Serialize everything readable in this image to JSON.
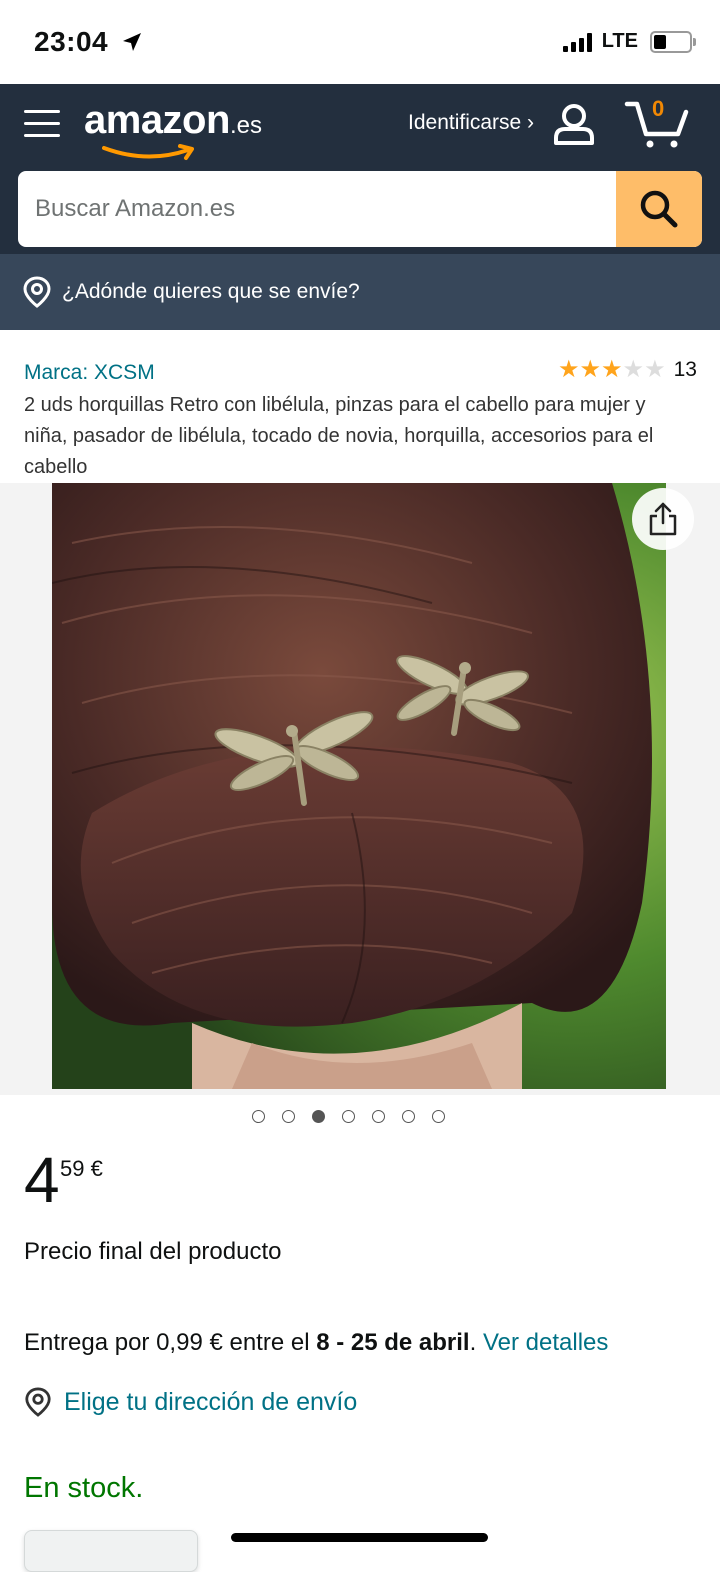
{
  "status_bar": {
    "time": "23:04",
    "network": "LTE"
  },
  "header": {
    "logo_word": "amazon",
    "logo_tld": ".es",
    "signin_label": "Identificarse ›",
    "cart_count": "0"
  },
  "search": {
    "placeholder": "Buscar Amazon.es"
  },
  "delivery_bar": {
    "text": "¿Adónde quieres que se envíe?"
  },
  "product": {
    "brand": "Marca: XCSM",
    "rating": 3,
    "rating_max": 5,
    "rating_count": "13",
    "title": "2 uds horquillas Retro con libélula, pinzas para el cabello para mujer y niña, pasador de libélula, tocado de novia, horquilla, accesorios para el cabello",
    "image_count": 7,
    "image_active_index": 2,
    "price_whole": "4",
    "price_fraction": "59 €",
    "price_note": "Precio final del producto",
    "delivery_prefix": "Entrega por 0,99 € entre el ",
    "delivery_dates": "8 - 25 de abril",
    "delivery_suffix": ". ",
    "delivery_link": "Ver detalles",
    "address_link": "Elige tu dirección de envío",
    "stock": "En stock."
  },
  "colors": {
    "nav": "#232f3e",
    "nav_secondary": "#37475a",
    "search_button": "#febd69",
    "link": "#007185",
    "stock": "#007600",
    "star": "#ffa41c"
  }
}
